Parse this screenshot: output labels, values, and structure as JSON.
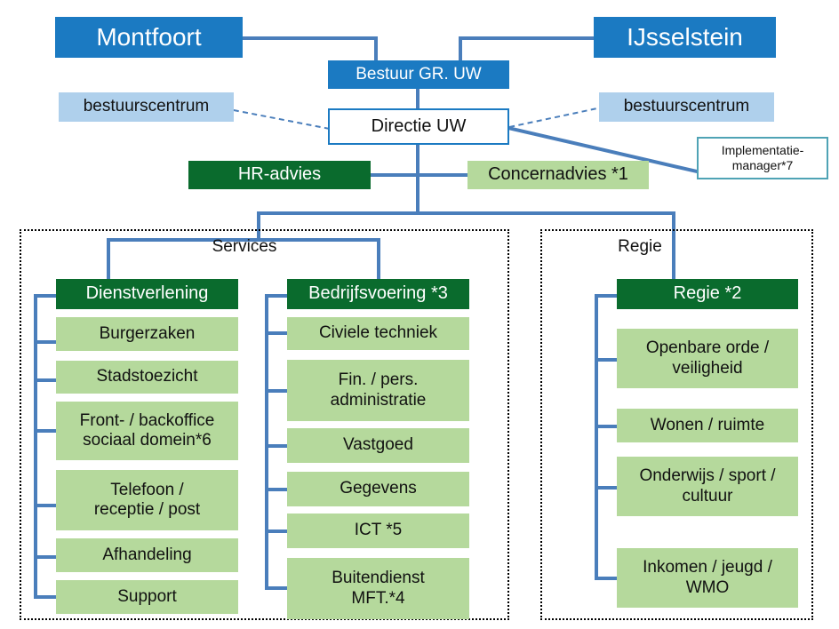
{
  "diagram": {
    "title_nodes": {
      "montfoort": "Montfoort",
      "ijsselstein": "IJsselstein",
      "bestuur": "Bestuur GR. UW",
      "directie": "Directie UW",
      "bestuurscentrum_left": "bestuurscentrum",
      "bestuurscentrum_right": "bestuurscentrum",
      "implementatiemanager": "Implementatie-\nmanager*7",
      "hr_advies": "HR-advies",
      "concernadvies": "Concernadvies *1"
    },
    "groups": [
      {
        "label": "Services"
      },
      {
        "label": "Regie"
      }
    ],
    "columns": [
      {
        "head": "Dienstverlening",
        "items": [
          "Burgerzaken",
          "Stadstoezicht",
          "Front- / backoffice\nsociaal domein*6",
          "Telefoon /\nreceptie / post",
          "Afhandeling",
          "Support"
        ]
      },
      {
        "head": "Bedrijfsvoering  *3",
        "items": [
          "Civiele techniek",
          "Fin. / pers.\nadministratie",
          "Vastgoed",
          "Gegevens",
          "ICT *5",
          "Buitendienst\nMFT.*4"
        ]
      },
      {
        "head": "Regie *2",
        "items": [
          "Openbare orde /\nveiligheid",
          "Wonen / ruimte",
          "Onderwijs / sport /\ncultuur",
          "Inkomen / jeugd /\nWMO"
        ]
      }
    ],
    "colors": {
      "blue_dark": "#1B7AC2",
      "blue_light": "#AFD0EC",
      "green_dark": "#0A6B2D",
      "green_light": "#B5D99C",
      "connector": "#4A7EBB",
      "teal_border": "#4FA3B5",
      "container_border": "#000000"
    }
  }
}
